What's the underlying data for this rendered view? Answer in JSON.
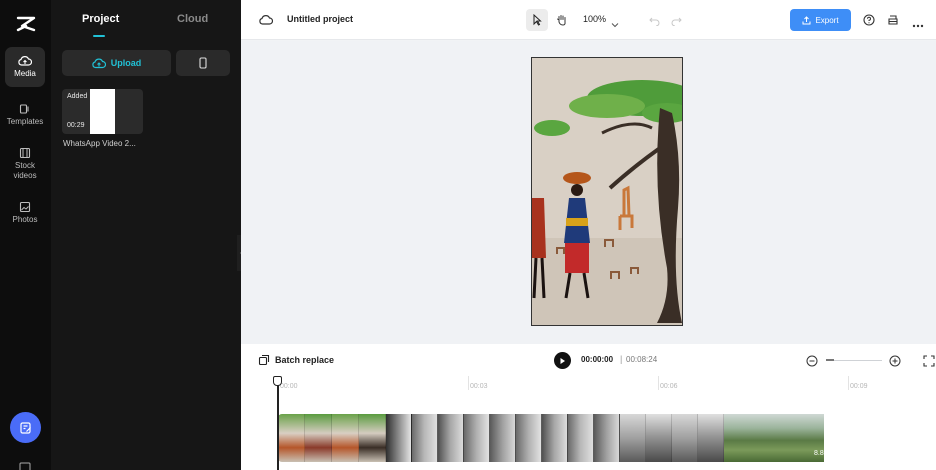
{
  "rail": {
    "items": [
      {
        "label": "Media"
      },
      {
        "label": "Templates"
      },
      {
        "label": "Stock videos"
      },
      {
        "label": "Photos"
      }
    ]
  },
  "panel": {
    "tabs": [
      "Project",
      "Cloud"
    ],
    "upload_label": "Upload",
    "media": [
      {
        "badge": "Added",
        "duration": "00:29",
        "name": "WhatsApp Video 2..."
      }
    ]
  },
  "topbar": {
    "project_title": "Untitled project",
    "zoom": "100%",
    "export_label": "Export"
  },
  "timeline": {
    "batch_label": "Batch replace",
    "current_time": "00:00:00",
    "separator": "|",
    "total_time": "00:08:24",
    "ruler": [
      "00:00",
      "00:03",
      "00:06",
      "00:09"
    ],
    "clip_duration": "8.8s"
  },
  "colors": {
    "accent": "#21c1d6",
    "export": "#3e8ef7",
    "fab": "#4a6cf7"
  }
}
